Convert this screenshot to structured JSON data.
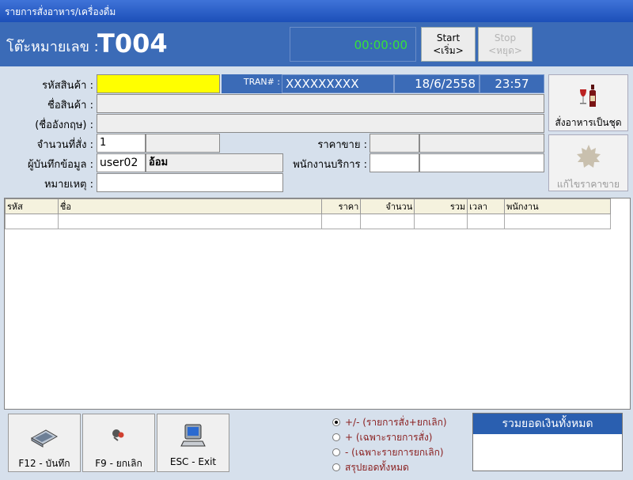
{
  "window": {
    "title": "รายการสั่งอาหาร/เครื่องดื่ม"
  },
  "header": {
    "table_label": "โต๊ะหมายเลข :",
    "table_number": "T004",
    "timer": "00:00:00",
    "start_label": "Start",
    "start_sub": "<เริ่ม>",
    "stop_label": "Stop",
    "stop_sub": "<หยุด>"
  },
  "form": {
    "product_code_label": "รหัสสินค้า :",
    "product_code_value": "",
    "tran_label": "TRAN# :",
    "tran_value": "XXXXXXXXX",
    "date_value": "18/6/2558",
    "time_value": "23:57",
    "product_name_label": "ชื่อสินค้า :",
    "product_name_value": "",
    "english_name_label": "(ชื่ออังกฤษ) :",
    "english_name_value": "",
    "qty_label": "จำนวนที่สั่ง :",
    "qty_value": "1",
    "price_label": "ราคาขาย :",
    "price_value": "",
    "recorder_label": "ผู้บันทึกข้อมูล :",
    "recorder_id": "user02",
    "recorder_name": "อ้อม",
    "service_staff_label": "พนักงานบริการ :",
    "note_label": "หมายเหตุ :",
    "note_value": ""
  },
  "side_buttons": {
    "set_menu_label": "สั่งอาหารเป็นชุด",
    "edit_price_label": "แก้ไขราคาขาย"
  },
  "grid": {
    "columns": [
      "รหัส",
      "ชื่อ",
      "ราคา",
      "จำนวน",
      "รวม",
      "เวลา",
      "พนักงาน"
    ]
  },
  "bottom": {
    "save_label": "F12 - บันทึก",
    "cancel_label": "F9 - ยกเลิก",
    "exit_label": "ESC - Exit",
    "filters": [
      {
        "label": "+/- (รายการสั่ง+ยกเลิก)",
        "selected": true
      },
      {
        "label": "+ (เฉพาะรายการสั่ง)",
        "selected": false
      },
      {
        "label": "- (เฉพาะรายการยกเลิก)",
        "selected": false
      },
      {
        "label": "สรุปยอดทั้งหมด",
        "selected": false
      }
    ],
    "total_title": "รวมยอดเงินทั้งหมด",
    "total_value": ""
  },
  "colors": {
    "header_blue": "#3b6bb7",
    "timer_green": "#36e23a",
    "code_field_yellow": "#ffff00"
  }
}
